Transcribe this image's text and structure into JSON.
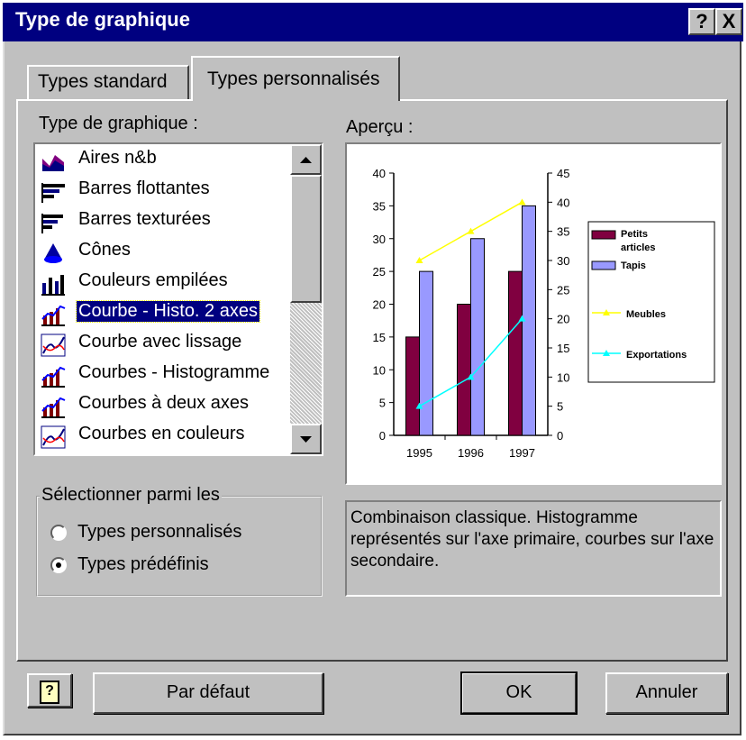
{
  "window": {
    "title": "Type de graphique",
    "help_glyph": "?",
    "close_glyph": "X"
  },
  "tabs": [
    {
      "label": "Types standard"
    },
    {
      "label": "Types personnalisés"
    }
  ],
  "list": {
    "label": "Type de graphique :",
    "items": [
      {
        "label": "Aires n&b",
        "icon": "area-chart-icon"
      },
      {
        "label": "Barres flottantes",
        "icon": "floating-bar-icon"
      },
      {
        "label": "Barres texturées",
        "icon": "textured-bar-icon"
      },
      {
        "label": "Cônes",
        "icon": "cone-icon"
      },
      {
        "label": "Couleurs empilées",
        "icon": "stacked-column-icon"
      },
      {
        "label": "Courbe - Histo. 2 axes",
        "icon": "line-column-icon",
        "selected": true
      },
      {
        "label": "Courbe avec lissage",
        "icon": "smooth-line-icon"
      },
      {
        "label": "Courbes - Histogramme",
        "icon": "line-column-icon"
      },
      {
        "label": "Courbes à deux axes",
        "icon": "line-column-icon"
      },
      {
        "label": "Courbes en couleurs",
        "icon": "smooth-line-icon"
      }
    ]
  },
  "preview": {
    "label": "Aperçu :"
  },
  "chart_data": {
    "type": "bar",
    "categories": [
      "1995",
      "1996",
      "1997"
    ],
    "series": [
      {
        "name": "Petits articles",
        "kind": "bar",
        "axis": "primary",
        "color": "#800040",
        "values": [
          15,
          20,
          25
        ]
      },
      {
        "name": "Tapis",
        "kind": "bar",
        "axis": "primary",
        "color": "#9999ff",
        "values": [
          25,
          30,
          35
        ]
      },
      {
        "name": "Meubles",
        "kind": "line",
        "axis": "secondary",
        "color": "#ffff00",
        "values": [
          30,
          35,
          40
        ]
      },
      {
        "name": "Exportations",
        "kind": "line",
        "axis": "secondary",
        "color": "#00ffff",
        "values": [
          5,
          10,
          20
        ]
      }
    ],
    "ylim": [
      0,
      40
    ],
    "y2lim": [
      0,
      45
    ],
    "yticks": [
      0,
      5,
      10,
      15,
      20,
      25,
      30,
      35,
      40
    ],
    "y2ticks": [
      0,
      5,
      10,
      15,
      20,
      25,
      30,
      35,
      40,
      45
    ],
    "legend_labels": [
      "Petits articles",
      "Tapis",
      "Meubles",
      "Exportations"
    ],
    "legend_position": "right",
    "grid": false
  },
  "group": {
    "title": "Sélectionner parmi les",
    "options": [
      {
        "label": "Types personnalisés",
        "checked": false
      },
      {
        "label": "Types prédéfinis",
        "checked": true
      }
    ]
  },
  "description": "Combinaison classique. Histogramme représentés sur l'axe primaire, courbes sur l'axe secondaire.",
  "buttons": {
    "help_glyph": "?",
    "default_label": "Par défaut",
    "ok_label": "OK",
    "cancel_label": "Annuler"
  }
}
